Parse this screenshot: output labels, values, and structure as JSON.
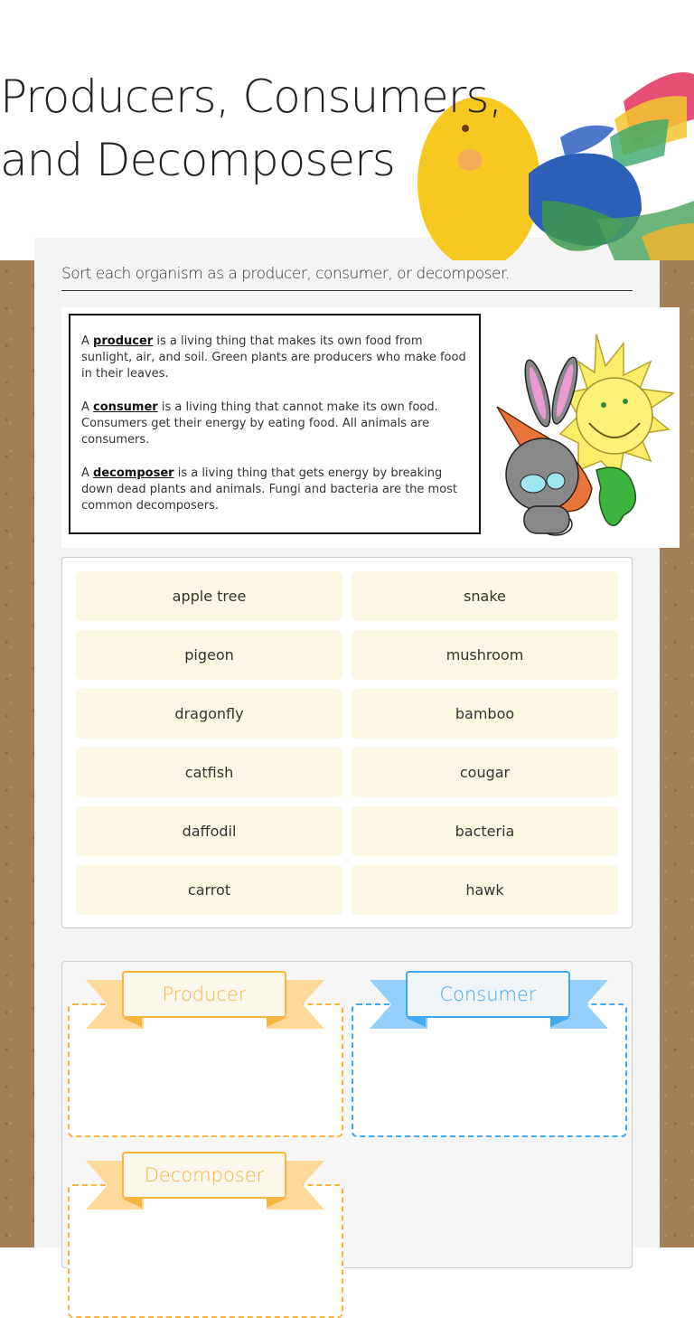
{
  "page": {
    "title": "Producers, Consumers, and Decomposers",
    "instructions": "Sort each organism as a producer, consumer, or decomposer."
  },
  "definitions": [
    {
      "article": "A",
      "term": "producer",
      "text": "is a living thing that makes its own food from sunlight, air, and soil.  Green plants are producers who make food in their leaves."
    },
    {
      "article": "A",
      "term": "consumer",
      "text": "is a living thing that cannot make its own food.  Consumers get their energy by eating food.  All animals are consumers."
    },
    {
      "article": "A",
      "term": "decomposer",
      "text": "is a living thing that gets energy by breaking down dead plants and animals.  Fungi and bacteria are the most common decomposers."
    }
  ],
  "cards": [
    "apple tree",
    "snake",
    "pigeon",
    "mushroom",
    "dragonfly",
    "bamboo",
    "catfish",
    "cougar",
    "daffodil",
    "bacteria",
    "carrot",
    "hawk"
  ],
  "bins": [
    {
      "label": "Producer",
      "color": "#fbb33e",
      "tail_color": "#fed99a",
      "bg": "#fcf7ed"
    },
    {
      "label": "Consumer",
      "color": "#42a8f0",
      "tail_color": "#94d0fb",
      "bg": "#f0f5f9"
    },
    {
      "label": "Decomposer",
      "color": "#fbb33e",
      "tail_color": "#fed99a",
      "bg": "#fcf7ed"
    }
  ]
}
